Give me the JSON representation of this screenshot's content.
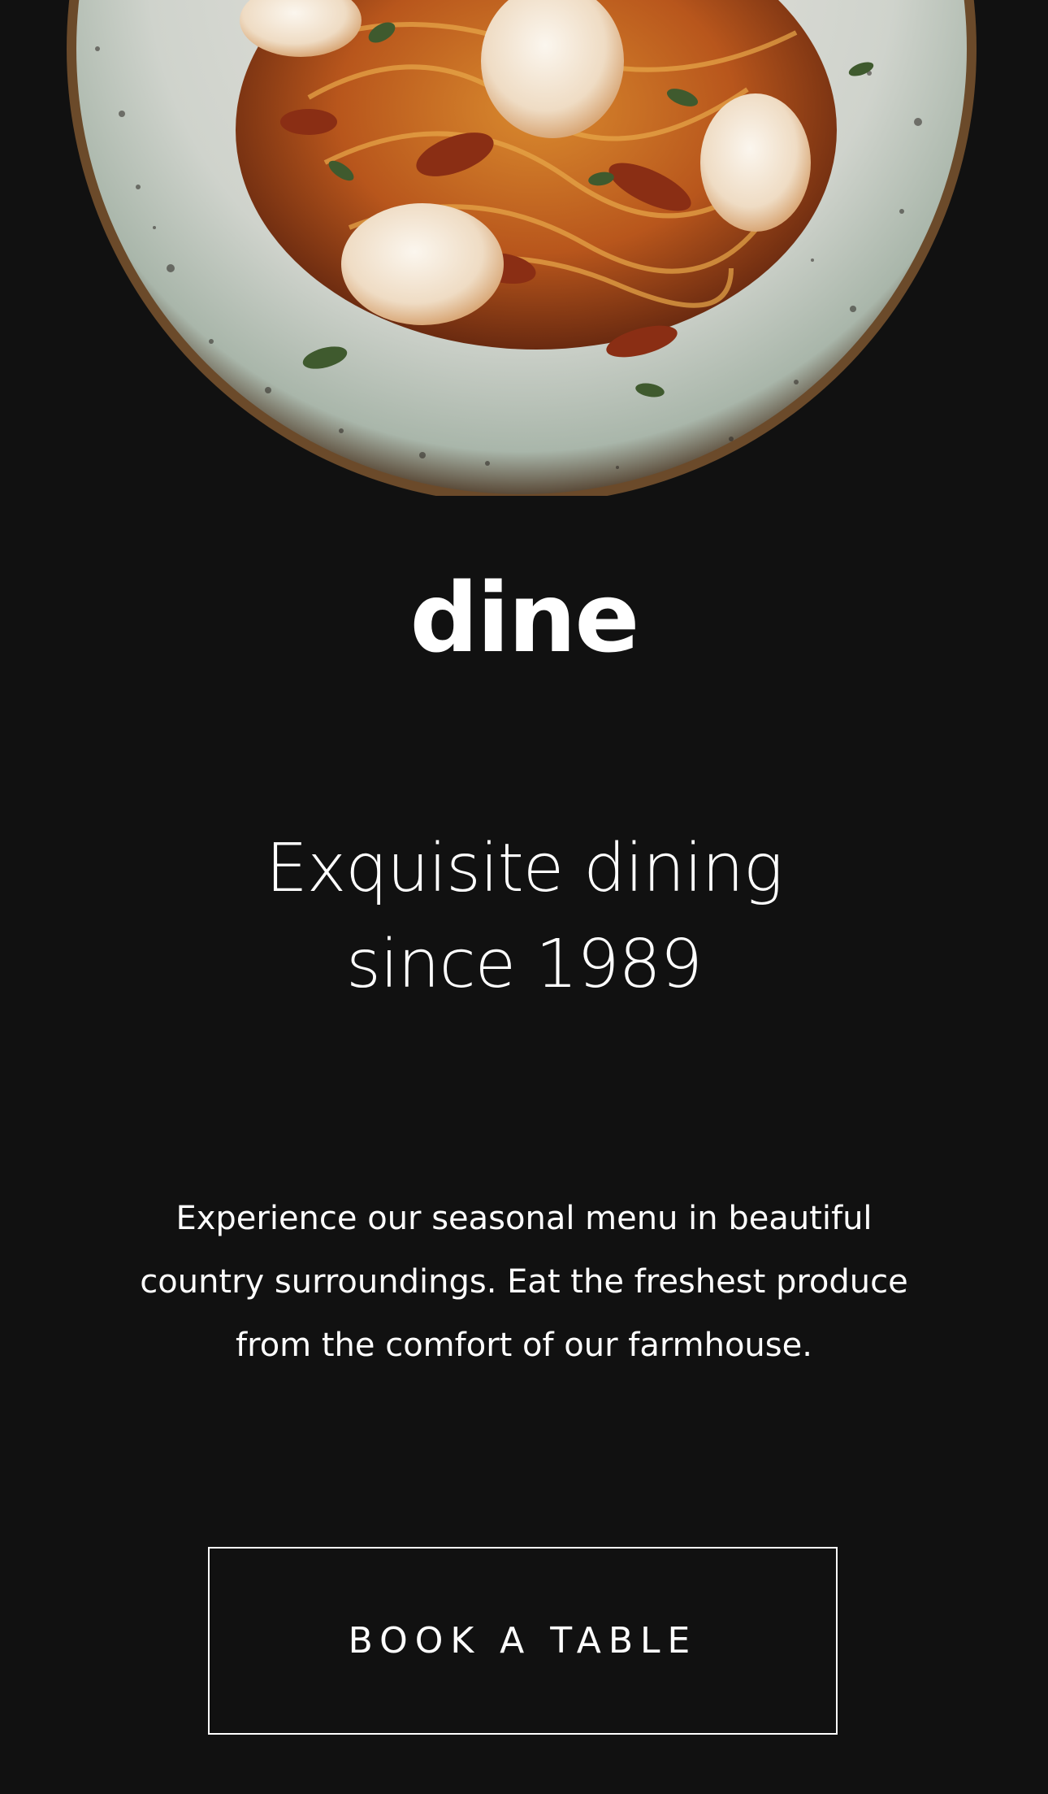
{
  "hero": {
    "image_alt": "Plate of spaghetti with shrimp and herbs"
  },
  "brand": {
    "logo_text": "dine"
  },
  "headline": {
    "line1": "Exquisite dining",
    "line2": "since 1989"
  },
  "intro": {
    "text": "Experience our seasonal menu in beautiful country surroundings. Eat the freshest produce from the comfort of our farmhouse."
  },
  "cta": {
    "label": "BOOK A TABLE"
  },
  "colors": {
    "background": "#111111",
    "text": "#ffffff"
  }
}
